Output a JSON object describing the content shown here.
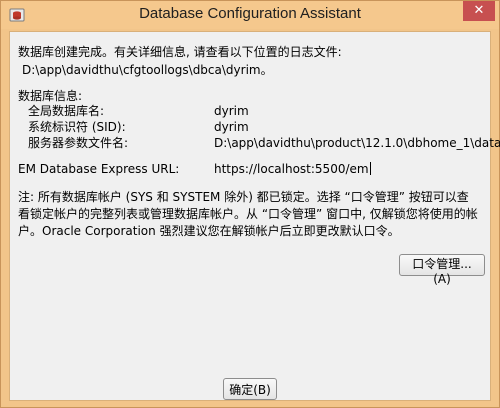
{
  "window": {
    "title": "Database Configuration Assistant",
    "close_symbol": "✕"
  },
  "message": {
    "completion": "数据库创建完成。有关详细信息, 请查看以下位置的日志文件:",
    "log_path": "D:\\app\\davidthu\\cfgtoollogs\\dbca\\dyrim。"
  },
  "db_info": {
    "heading": "数据库信息:",
    "fields": [
      {
        "label": "全局数据库名:",
        "value": "dyrim"
      },
      {
        "label": "系统标识符 (SID):",
        "value": "dyrim"
      },
      {
        "label": "服务器参数文件名:",
        "value": "D:\\app\\davidthu\\product\\12.1.0\\dbhome_1\\data..."
      }
    ]
  },
  "em": {
    "label": "EM Database Express URL:",
    "url": "https://localhost:5500/em"
  },
  "note": "注: 所有数据库帐户 (SYS 和 SYSTEM 除外) 都已锁定。选择 “口令管理” 按钮可以查看锁定帐户的完整列表或管理数据库帐户。从 “口令管理” 窗口中, 仅解锁您将使用的帐户。Oracle Corporation 强烈建议您在解锁帐户后立即更改默认口令。",
  "buttons": {
    "password_management": "口令管理...(A)",
    "ok": "确定(B)"
  },
  "colors": {
    "title_bar": "#f5c88d",
    "close_button": "#c75050",
    "panel": "#f0f0f0"
  }
}
